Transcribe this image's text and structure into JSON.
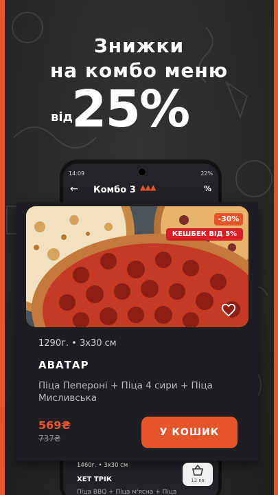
{
  "promo": {
    "line1": "Знижки",
    "line2": "на комбо меню",
    "prefix": "від",
    "value": "25%"
  },
  "phone": {
    "status_time": "14:09",
    "status_right": "22%",
    "app_title": "Комбо 3",
    "title_decoration": "pizza-slice-icons",
    "filter_symbol": "%"
  },
  "card": {
    "discount_badge": "-30%",
    "cashback_badge": "КЕШБЕК ВІД 5%",
    "meta": "1290г. • 3х30 см",
    "name": "АВАТАР",
    "description": "Піца Пепероні + Піца 4 сири + Піца Мисливська",
    "price": "569₴",
    "old_price": "737₴",
    "cart_button": "У КОШИК"
  },
  "next_item": {
    "meta": "1460г. • 3х30 см",
    "name": "ХЕТ ТРІК",
    "description": "Піца BBQ + Піца м'ясна + Піца",
    "cart_label": "12 кв"
  },
  "colors": {
    "accent": "#e4562a",
    "cashback": "#d81f26",
    "background": "#262626"
  }
}
